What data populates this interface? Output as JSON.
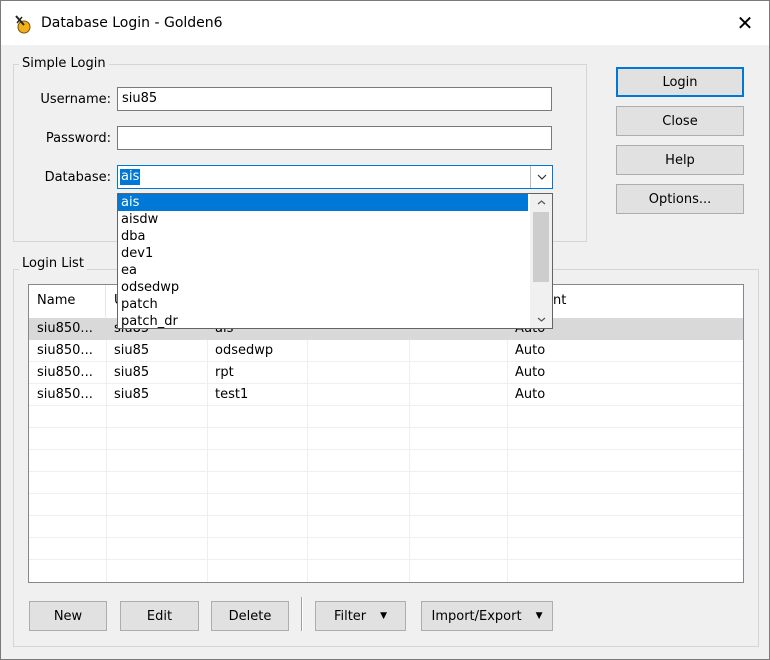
{
  "window": {
    "title": "Database Login - Golden6",
    "close_glyph": "✕"
  },
  "simple_login": {
    "group_label": "Simple Login",
    "username_label": "Username:",
    "username_value": "siu85",
    "password_label": "Password:",
    "password_value": "",
    "database_label": "Database:",
    "database_value": "ais",
    "database_options": [
      "ais",
      "aisdw",
      "dba",
      "dev1",
      "ea",
      "odsedwp",
      "patch",
      "patch_dr"
    ]
  },
  "buttons": {
    "login": "Login",
    "close": "Close",
    "help": "Help",
    "options": "Options..."
  },
  "login_list": {
    "group_label": "Login List",
    "columns": [
      "Name",
      "U",
      "",
      "",
      "",
      "ent"
    ],
    "rows": [
      {
        "name": "siu850...",
        "user": "siu85",
        "database": "ais",
        "mode": "Auto",
        "selected": true
      },
      {
        "name": "siu850...",
        "user": "siu85",
        "database": "odsedwp",
        "mode": "Auto",
        "selected": false
      },
      {
        "name": "siu850...",
        "user": "siu85",
        "database": "rpt",
        "mode": "Auto",
        "selected": false
      },
      {
        "name": "siu850...",
        "user": "siu85",
        "database": "test1",
        "mode": "Auto",
        "selected": false
      }
    ]
  },
  "bottom_buttons": {
    "new": "New",
    "edit": "Edit",
    "delete": "Delete",
    "filter": "Filter",
    "import_export": "Import/Export"
  }
}
